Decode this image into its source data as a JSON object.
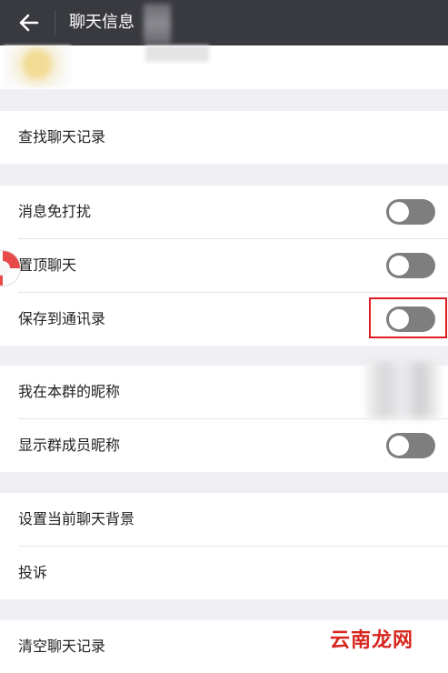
{
  "header": {
    "title": "聊天信息",
    "back_icon": "arrow-left-icon"
  },
  "sections": {
    "search": {
      "label": "查找聊天记录"
    },
    "settings": [
      {
        "label": "消息免打扰",
        "toggle": "off"
      },
      {
        "label": "置顶聊天",
        "toggle": "off"
      },
      {
        "label": "保存到通讯录",
        "toggle": "off"
      }
    ],
    "profile": [
      {
        "label": "我在本群的昵称"
      },
      {
        "label": "显示群成员昵称",
        "toggle": "off"
      }
    ],
    "misc": [
      {
        "label": "设置当前聊天背景"
      },
      {
        "label": "投诉"
      }
    ],
    "clear": {
      "label": "清空聊天记录"
    }
  },
  "watermark": "云南龙网",
  "colors": {
    "topbar": "#393a3f",
    "toggle_off": "#7e7e7e",
    "highlight": "#e11b22"
  }
}
